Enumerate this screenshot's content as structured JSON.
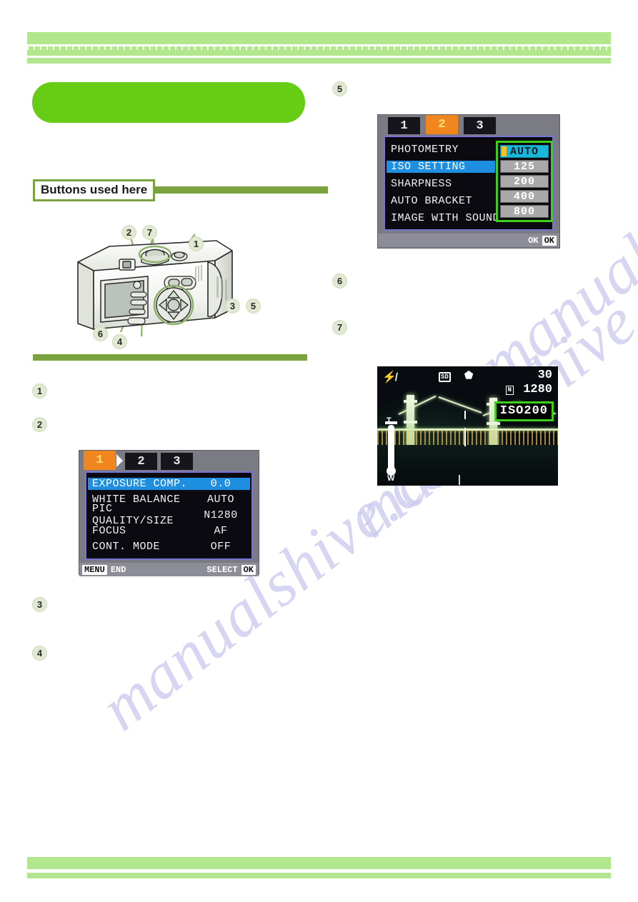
{
  "page": {
    "watermark_text": "manualshive.com",
    "accent_green": "#66cc14",
    "bar_green": "#b2e78d",
    "rule_green": "#7aa33f",
    "tab_orange": "#f2861e",
    "highlight_blue": "#1e8fe0",
    "callout_green": "#3ecf1c"
  },
  "section": {
    "tag_label": "Buttons used here"
  },
  "camera": {
    "callouts": [
      "1",
      "2",
      "3",
      "4",
      "5",
      "6",
      "7"
    ],
    "alt": "rear view of compact digital camera with numbered button callouts"
  },
  "steps": {
    "left": [
      "1",
      "2",
      "3",
      "4"
    ],
    "right": [
      "5",
      "6",
      "7"
    ]
  },
  "lcd_menu_1": {
    "tabs": [
      {
        "label": "1",
        "active": true
      },
      {
        "label": "2",
        "active": false
      },
      {
        "label": "3",
        "active": false
      }
    ],
    "rows": [
      {
        "label": "EXPOSURE COMP.",
        "value": "0.0",
        "selected": true
      },
      {
        "label": "WHITE BALANCE",
        "value": "AUTO",
        "selected": false
      },
      {
        "label": "PIC QUALITY/SIZE",
        "value": "N1280",
        "selected": false
      },
      {
        "label": "FOCUS",
        "value": "AF",
        "selected": false
      },
      {
        "label": "CONT. MODE",
        "value": "OFF",
        "selected": false
      }
    ],
    "footer": {
      "left_key": "MENU",
      "left_label": "END",
      "right_label": "SELECT",
      "right_key": "OK"
    }
  },
  "lcd_menu_2": {
    "tabs": [
      {
        "label": "1",
        "active": false
      },
      {
        "label": "2",
        "active": true
      },
      {
        "label": "3",
        "active": false
      }
    ],
    "rows": [
      {
        "label": "PHOTOMETRY",
        "selected": false
      },
      {
        "label": "ISO SETTING",
        "selected": true
      },
      {
        "label": "SHARPNESS",
        "selected": false
      },
      {
        "label": "AUTO BRACKET",
        "selected": false
      },
      {
        "label": "IMAGE WITH SOUND",
        "selected": false
      }
    ],
    "iso_options": [
      {
        "label": "AUTO",
        "highlighted": true
      },
      {
        "label": "125",
        "highlighted": false
      },
      {
        "label": "200",
        "highlighted": false
      },
      {
        "label": "400",
        "highlighted": false
      },
      {
        "label": "800",
        "highlighted": false
      }
    ],
    "footer": {
      "right_label": "OK",
      "right_key": "OK"
    }
  },
  "lcd_preview": {
    "flash_icon": "flash-off-icon",
    "sd_icon": "SD",
    "mode_icon": "still-camera-icon",
    "shots_remaining": "30",
    "quality_icon": "N",
    "resolution": "1280",
    "iso_badge": "ISO200",
    "zoom_tele_letter": "T",
    "zoom_wide_letter": "W",
    "scene": "night view of Rainbow Bridge"
  }
}
